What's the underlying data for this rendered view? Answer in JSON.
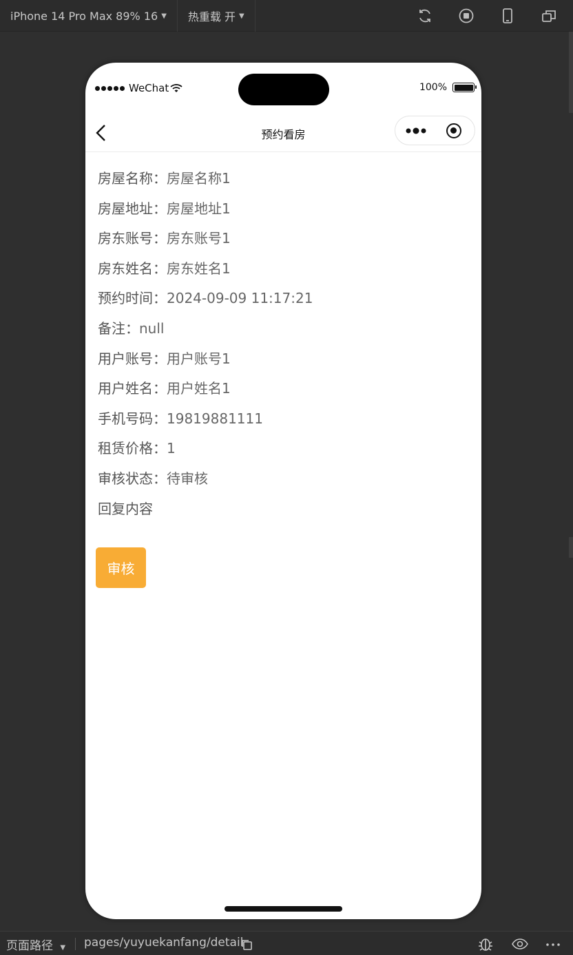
{
  "toolbar": {
    "device": "iPhone 14 Pro Max 89% 16",
    "hot_reload": "热重载 开",
    "icons": [
      "refresh-icon",
      "stop-icon",
      "phone-icon",
      "window-icon"
    ]
  },
  "status_bar": {
    "carrier": "WeChat",
    "battery": "100%"
  },
  "navbar": {
    "title": "预约看房"
  },
  "details": [
    {
      "label": "房屋名称：",
      "value": "房屋名称1"
    },
    {
      "label": "房屋地址：",
      "value": "房屋地址1"
    },
    {
      "label": "房东账号：",
      "value": "房东账号1"
    },
    {
      "label": "房东姓名：",
      "value": "房东姓名1"
    },
    {
      "label": "预约时间：",
      "value": "2024-09-09 11:17:21"
    },
    {
      "label": "备注：",
      "value": "null"
    },
    {
      "label": "用户账号：",
      "value": "用户账号1"
    },
    {
      "label": "用户姓名：",
      "value": "用户姓名1"
    },
    {
      "label": "手机号码：",
      "value": "19819881111"
    },
    {
      "label": "租赁价格：",
      "value": "1"
    },
    {
      "label": "审核状态：",
      "value": "待审核"
    },
    {
      "label": "回复内容",
      "value": ""
    }
  ],
  "audit_button": "审核",
  "colors": {
    "accent": "#f8ac35"
  },
  "bottom_bar": {
    "path_label": "页面路径",
    "path": "pages/yuyuekanfang/detail"
  }
}
